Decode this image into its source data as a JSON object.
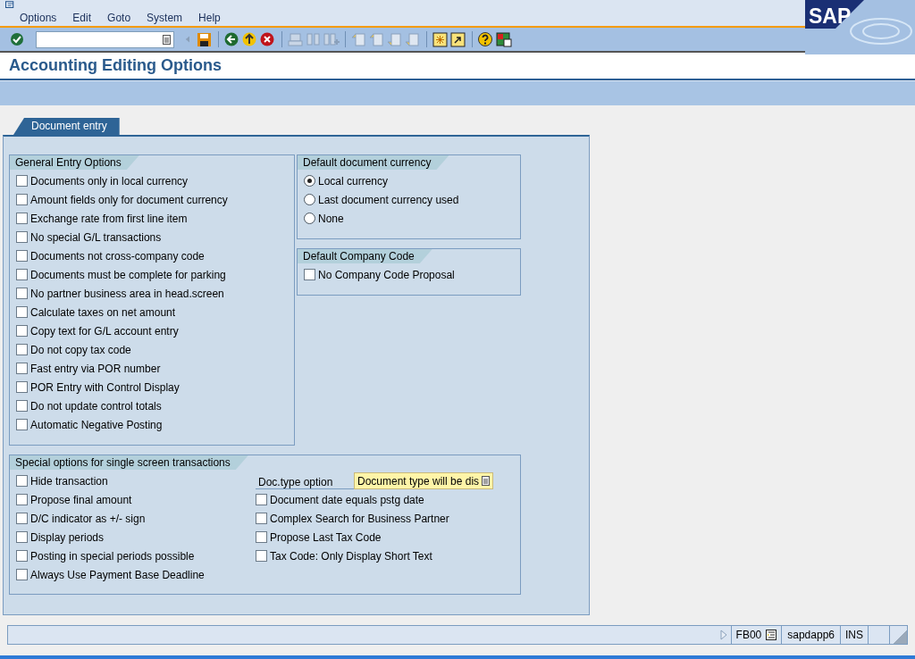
{
  "menu": [
    "Options",
    "Edit",
    "Goto",
    "System",
    "Help"
  ],
  "logo": "SAP",
  "title": "Accounting Editing Options",
  "tabs": [
    {
      "label": "Document entry",
      "selected": true
    }
  ],
  "general_entry_options": {
    "title": "General Entry Options",
    "items": [
      {
        "label": "Documents only in local currency",
        "checked": false
      },
      {
        "label": "Amount fields only for document currency",
        "checked": false
      },
      {
        "label": "Exchange rate from first line item",
        "checked": false
      },
      {
        "label": "No special G/L transactions",
        "checked": false
      },
      {
        "label": "Documents not cross-company code",
        "checked": false
      },
      {
        "label": "Documents must be complete for parking",
        "checked": false
      },
      {
        "label": "No partner business area in head.screen",
        "checked": false
      },
      {
        "label": "Calculate taxes on net amount",
        "checked": false
      },
      {
        "label": "Copy text for G/L account entry",
        "checked": false
      },
      {
        "label": "Do not copy tax code",
        "checked": false
      },
      {
        "label": "Fast entry via POR number",
        "checked": false
      },
      {
        "label": "POR Entry with Control Display",
        "checked": false
      },
      {
        "label": "Do not update control totals",
        "checked": false
      },
      {
        "label": "Automatic Negative Posting",
        "checked": false
      }
    ]
  },
  "default_document_currency": {
    "title": "Default document currency",
    "options": [
      {
        "label": "Local currency",
        "selected": true
      },
      {
        "label": "Last document currency used",
        "selected": false
      },
      {
        "label": "None",
        "selected": false
      }
    ]
  },
  "default_company_code": {
    "title": "Default Company Code",
    "items": [
      {
        "label": "No Company Code Proposal",
        "checked": false
      }
    ]
  },
  "special_options": {
    "title": "Special options for single screen transactions",
    "left_items": [
      {
        "label": "Hide transaction",
        "checked": false
      },
      {
        "label": "Propose final amount",
        "checked": false
      },
      {
        "label": "D/C indicator as +/- sign",
        "checked": false
      },
      {
        "label": "Display periods",
        "checked": false
      },
      {
        "label": "Posting in special periods possible",
        "checked": false
      },
      {
        "label": "Always Use Payment Base Deadline",
        "checked": false
      }
    ],
    "doc_type_option": {
      "label": "Doc.type option",
      "value": "Document type will be dis"
    },
    "right_items": [
      {
        "label": "Document date equals pstg date",
        "checked": false
      },
      {
        "label": "Complex Search for Business Partner",
        "checked": false
      },
      {
        "label": "Propose Last Tax Code",
        "checked": false
      },
      {
        "label": "Tax Code: Only Display Short Text",
        "checked": false
      }
    ]
  },
  "status_bar": {
    "transaction": "FB00",
    "server": "sapdapp6",
    "mode": "INS"
  }
}
